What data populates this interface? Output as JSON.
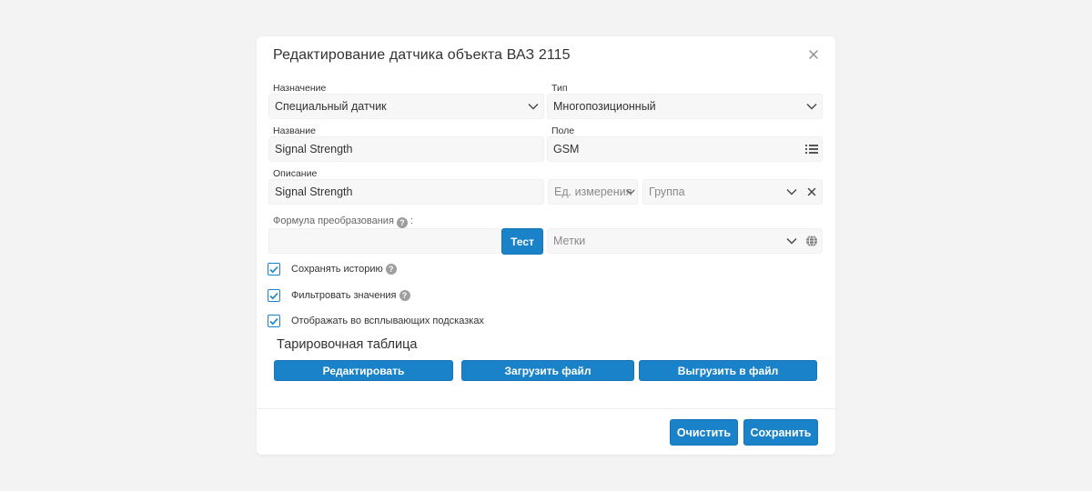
{
  "dialog": {
    "title": "Редактирование датчика объекта ВАЗ 2115"
  },
  "form": {
    "purpose": {
      "label": "Назначение",
      "value": "Специальный датчик"
    },
    "type": {
      "label": "Тип",
      "value": "Многопозиционный"
    },
    "name": {
      "label": "Название",
      "value": "Signal Strength"
    },
    "field": {
      "label": "Поле",
      "value": "GSM"
    },
    "description": {
      "label": "Описание",
      "value": "Signal Strength"
    },
    "unit": {
      "placeholder": "Ед. измерения"
    },
    "group": {
      "placeholder": "Группа"
    },
    "formula": {
      "label": "Формула преобразования",
      "suffix": ":",
      "value": ""
    },
    "test_button": "Тест",
    "tags": {
      "placeholder": "Метки"
    }
  },
  "checkboxes": [
    {
      "label": "Сохранять историю",
      "checked": true,
      "help": true
    },
    {
      "label": "Фильтровать значения",
      "checked": true,
      "help": true
    },
    {
      "label": "Отображать во всплывающих подсказках",
      "checked": true,
      "help": false
    }
  ],
  "calibration": {
    "title": "Тарировочная таблица",
    "edit": "Редактировать",
    "upload": "Загрузить файл",
    "download": "Выгрузить в файл"
  },
  "footer": {
    "clear": "Очистить",
    "save": "Сохранить"
  },
  "colors": {
    "accent": "#1a82c8",
    "background": "#f3f3f4",
    "field_bg": "#f7f7f7"
  },
  "icons": {
    "close": "close-icon",
    "dropdown": "chevron-down-icon",
    "list": "list-icon",
    "clear": "clear-x-icon",
    "globe": "globe-icon",
    "help": "help-icon",
    "check": "checkmark-icon"
  }
}
